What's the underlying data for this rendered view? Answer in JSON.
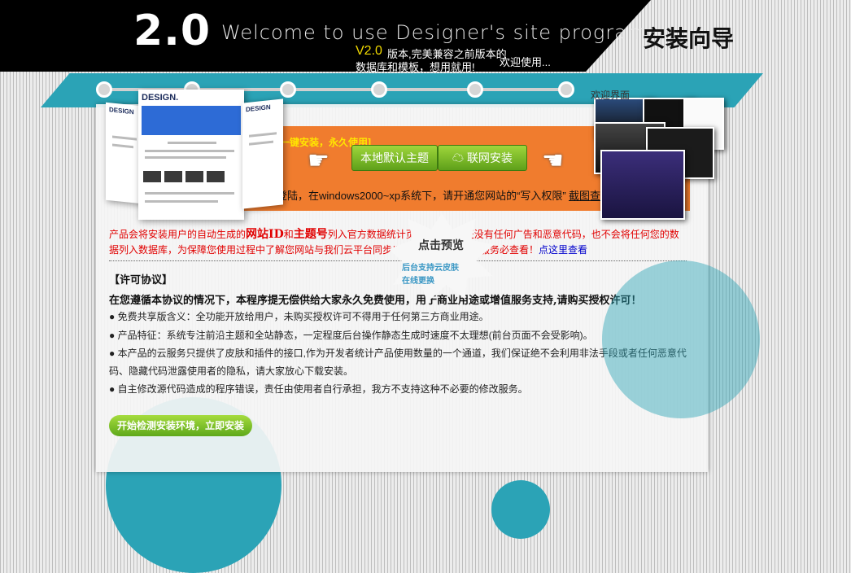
{
  "header": {
    "version": "2.0",
    "welcome": "Welcome to use Designer's site program",
    "wizard_title": "安装向导",
    "version_small": "V2.0",
    "note1": "版本,完美兼容之前版本的",
    "note2": "数据库和模板，想用就用!",
    "note3": "欢迎使用..."
  },
  "steps_bar": {
    "welcome_label": "欢迎界面"
  },
  "install": {
    "tip": "[一键安装，永久使用]",
    "local_button": "本地默认主题",
    "online_button": "联网安装",
    "env_note": "登陆，在windows2000~xp系统下，请开通您网站的“写入权限”",
    "env_link": "截图查看"
  },
  "screenshots": {
    "main_logo": "DESIGN.",
    "side_logo": "DESIGN"
  },
  "red_info": {
    "part1": "产品会将安装用户的自动生成的",
    "site_id": "网站ID",
    "part2": "和",
    "theme_id": "主题号",
    "part3": "列入官方数据统计页面，我们保证没有任何广告和恶意代码，也不会将任何您的数",
    "line2": "据列入数据库，为保障您使用过程中了解您网站与我们云平台同步以及安全，作为网站服务必查看！",
    "link": "点这里查看"
  },
  "license": {
    "title": "【许可协议】",
    "lead": "在您遵循本协议的情况下，本程序提无偿供给大家永久免费使用，用于商业用途或增值服务支持,请购买授权许可！",
    "items": [
      "● 免费共享版含义：全功能开放给用户，未购买授权许可不得用于任何第三方商业用途。",
      "● 产品特征：系统专注前沿主题和全站静态，一定程度后台操作静态生成时速度不太理想(前台页面不会受影响)。",
      "● 本产品的云服务只提供了皮肤和插件的接口,作为开发者统计产品使用数量的一个通道，我们保证绝不会利用非法手段或者任何恶意代",
      "码、隐藏代码泄露使用者的隐私，请大家放心下载安装。",
      "● 自主修改源代码造成的程序错误，责任由使用者自行承担，我方不支持这种不必要的修改服务。"
    ]
  },
  "start_button": "开始检测安装环境，立即安装",
  "starburst": {
    "main": "点击预览",
    "sub1": "后台支持云皮肤",
    "sub2": "在线更换"
  },
  "colors": {
    "teal": "#2ba3b6",
    "orange": "#f07c2e",
    "green": "#7cc02a",
    "red": "#e10000"
  }
}
